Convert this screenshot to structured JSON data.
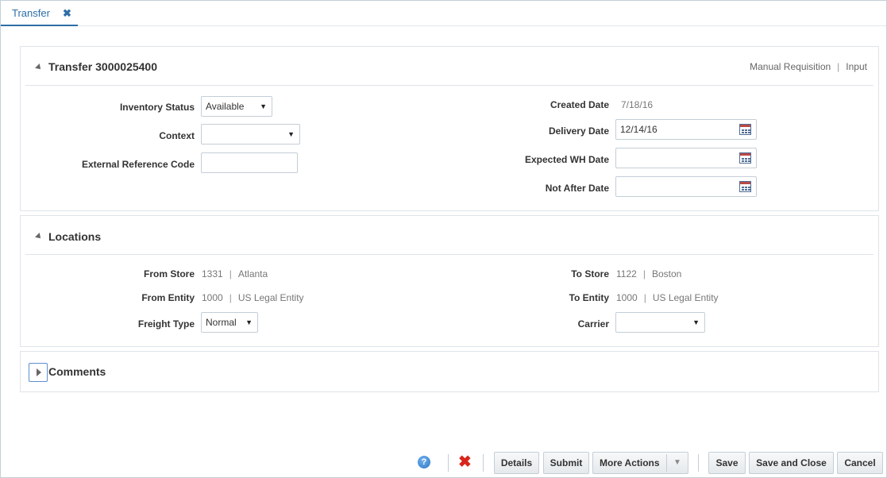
{
  "tab": {
    "label": "Transfer",
    "close": "✖"
  },
  "header": {
    "title": "Transfer 3000025400",
    "type": "Manual Requisition",
    "separator": "|",
    "status": "Input"
  },
  "details": {
    "inventory_status": {
      "label": "Inventory Status",
      "value": "Available"
    },
    "context": {
      "label": "Context",
      "value": ""
    },
    "external_reference_code": {
      "label": "External Reference Code",
      "value": ""
    },
    "created_date": {
      "label": "Created Date",
      "value": "7/18/16"
    },
    "delivery_date": {
      "label": "Delivery Date",
      "value": "12/14/16"
    },
    "expected_wh_date": {
      "label": "Expected WH Date",
      "value": ""
    },
    "not_after_date": {
      "label": "Not After Date",
      "value": ""
    }
  },
  "locations": {
    "title": "Locations",
    "from_store": {
      "label": "From Store",
      "id": "1331",
      "name": "Atlanta"
    },
    "from_entity": {
      "label": "From Entity",
      "id": "1000",
      "name": "US Legal Entity"
    },
    "freight_type": {
      "label": "Freight Type",
      "value": "Normal"
    },
    "to_store": {
      "label": "To Store",
      "id": "1122",
      "name": "Boston"
    },
    "to_entity": {
      "label": "To Entity",
      "id": "1000",
      "name": "US Legal Entity"
    },
    "carrier": {
      "label": "Carrier",
      "value": ""
    }
  },
  "comments": {
    "title": "Comments"
  },
  "toolbar": {
    "help": "?",
    "delete": "✖",
    "details": "Details",
    "submit": "Submit",
    "more_actions": "More Actions",
    "save": "Save",
    "save_and_close": "Save and Close",
    "cancel": "Cancel"
  },
  "colors": {
    "accent": "#2e6ea6",
    "delete": "#d8261c",
    "border": "#c4ced7"
  }
}
